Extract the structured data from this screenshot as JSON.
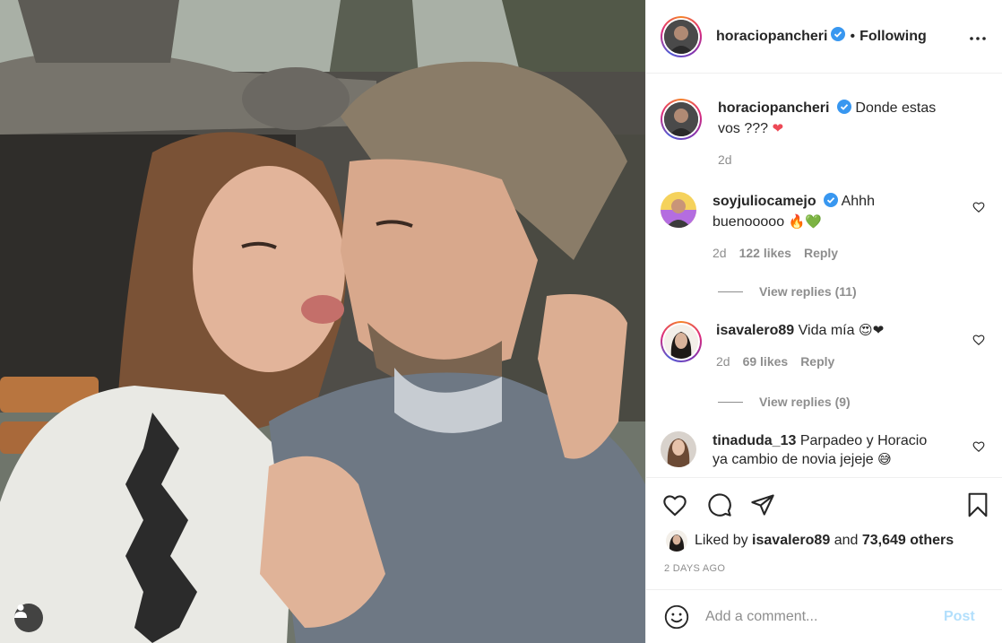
{
  "post": {
    "author": "horaciopancheri",
    "follow_status": "Following",
    "separator": "•",
    "caption": "Donde estas vos ???",
    "caption_emoji": "❤",
    "caption_age": "2d"
  },
  "comments": [
    {
      "username": "soyjuliocamejo",
      "verified": true,
      "text": "Ahhh buenooooo",
      "emoji": "🔥💚",
      "age": "2d",
      "likes": "122 likes",
      "reply": "Reply",
      "view_replies": "View replies (11)"
    },
    {
      "username": "isavalero89",
      "verified": false,
      "text": "Vida mía",
      "emoji": "😍❤",
      "age": "2d",
      "likes": "69 likes",
      "reply": "Reply",
      "view_replies": "View replies (9)"
    },
    {
      "username": "tinaduda_13",
      "verified": false,
      "text": "Parpadeo y Horacio ya cambio de novia jejeje",
      "emoji": "😅"
    }
  ],
  "likes": {
    "prefix": "Liked by",
    "user": "isavalero89",
    "joiner": "and",
    "others": "73,649 others"
  },
  "timestamp": "2 DAYS AGO",
  "comment_box": {
    "placeholder": "Add a comment...",
    "post_label": "Post"
  },
  "icons": {
    "more": "more-options-icon",
    "like": "heart-icon",
    "comment": "comment-icon",
    "share": "share-icon",
    "save": "bookmark-icon",
    "emoji": "emoji-icon",
    "tag": "user-tag-icon",
    "verified": "verified-badge-icon"
  },
  "colors": {
    "verified": "#3897f0",
    "text": "#262626",
    "muted": "#8e8e8e",
    "post_disabled": "#b2dffc"
  }
}
